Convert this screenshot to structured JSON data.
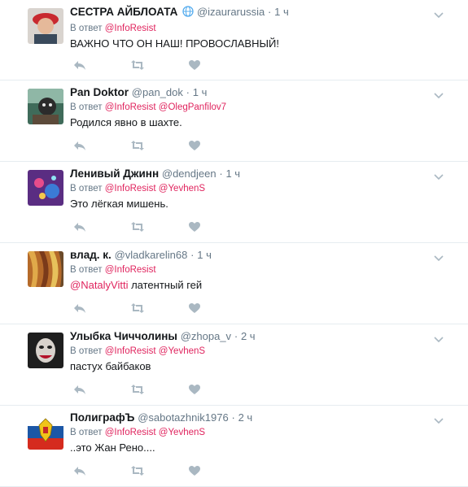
{
  "tweets": [
    {
      "fullname": "СЕСТРА АЙБЛОАТА",
      "verified_globe": true,
      "username": "@izaurarussia",
      "sep": "·",
      "time": "1 ч",
      "reply_prefix": "В ответ",
      "reply_to": [
        "@InfoResist"
      ],
      "text_parts": [
        "ВАЖНО ЧТО ОН НАШ! ПРОВОСЛАВНЫЙ!"
      ]
    },
    {
      "fullname": "Pan Doktor",
      "username": "@pan_dok",
      "sep": "·",
      "time": "1 ч",
      "reply_prefix": "В ответ",
      "reply_to": [
        "@InfoResist",
        "@OlegPanfilov7"
      ],
      "text_parts": [
        "Родился явно в шахте."
      ]
    },
    {
      "fullname": "Ленивый Джинн",
      "username": "@dendjeen",
      "sep": "·",
      "time": "1 ч",
      "reply_prefix": "В ответ",
      "reply_to": [
        "@InfoResist",
        "@YevhenS"
      ],
      "text_parts": [
        "Это лёгкая мишень."
      ]
    },
    {
      "fullname": "влад. к.",
      "username": "@vladkarelin68",
      "sep": "·",
      "time": "1 ч",
      "reply_prefix": "В ответ",
      "reply_to": [
        "@InfoResist"
      ],
      "text_mention": "@NatalyVitti",
      "text_parts": [
        " латентный гей"
      ]
    },
    {
      "fullname": "Улыбка Чиччолины",
      "username": "@zhopa_v",
      "sep": "·",
      "time": "2 ч",
      "reply_prefix": "В ответ",
      "reply_to": [
        "@InfoResist",
        "@YevhenS"
      ],
      "text_parts": [
        "пастух байбаков"
      ]
    },
    {
      "fullname": "ПолиграфЪ",
      "username": "@sabotazhnik1976",
      "sep": "·",
      "time": "2 ч",
      "reply_prefix": "В ответ",
      "reply_to": [
        "@InfoResist",
        "@YevhenS"
      ],
      "text_parts": [
        "..это Жан Рено...."
      ]
    }
  ],
  "icons": {
    "reply": "reply-icon",
    "retweet": "retweet-icon",
    "like": "heart-icon",
    "menu": "chevron-down-icon",
    "verified": "globe-icon"
  },
  "colors": {
    "link": "#e0245e",
    "muted": "#657786",
    "action": "#aab8c2",
    "border": "#e6ecf0"
  }
}
